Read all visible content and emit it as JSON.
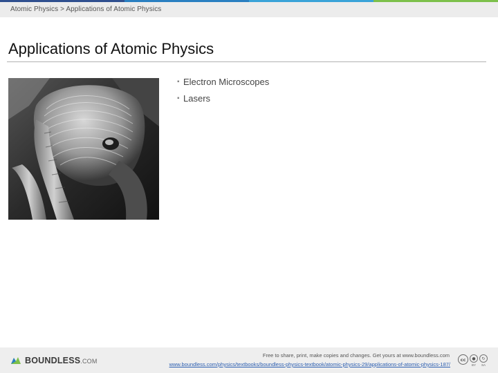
{
  "colors": {
    "topbar": [
      "#2f4f8f",
      "#2a7fc1",
      "#3aa3d8",
      "#7cc04a"
    ],
    "link": "#2a5db0"
  },
  "breadcrumb": {
    "text": "Atomic Physics > Applications of Atomic Physics"
  },
  "page": {
    "title": "Applications of Atomic Physics"
  },
  "content": {
    "image_subject": "scanning electron micrograph of an ant head",
    "bullets": [
      "Electron Microscopes",
      "Lasers"
    ],
    "bullet_glyph": "▪"
  },
  "footer": {
    "logo_name": "BOUNDLESS",
    "logo_suffix": ".COM",
    "share_text": "Free to share, print, make copies and changes. Get yours at www.boundless.com",
    "url": "www.boundless.com/physics/textbooks/boundless-physics-textbook/atomic-physics-29/applications-of-atomic-physics-187/",
    "license": {
      "cc": "cc",
      "by": "BY",
      "sa": "SA"
    }
  }
}
